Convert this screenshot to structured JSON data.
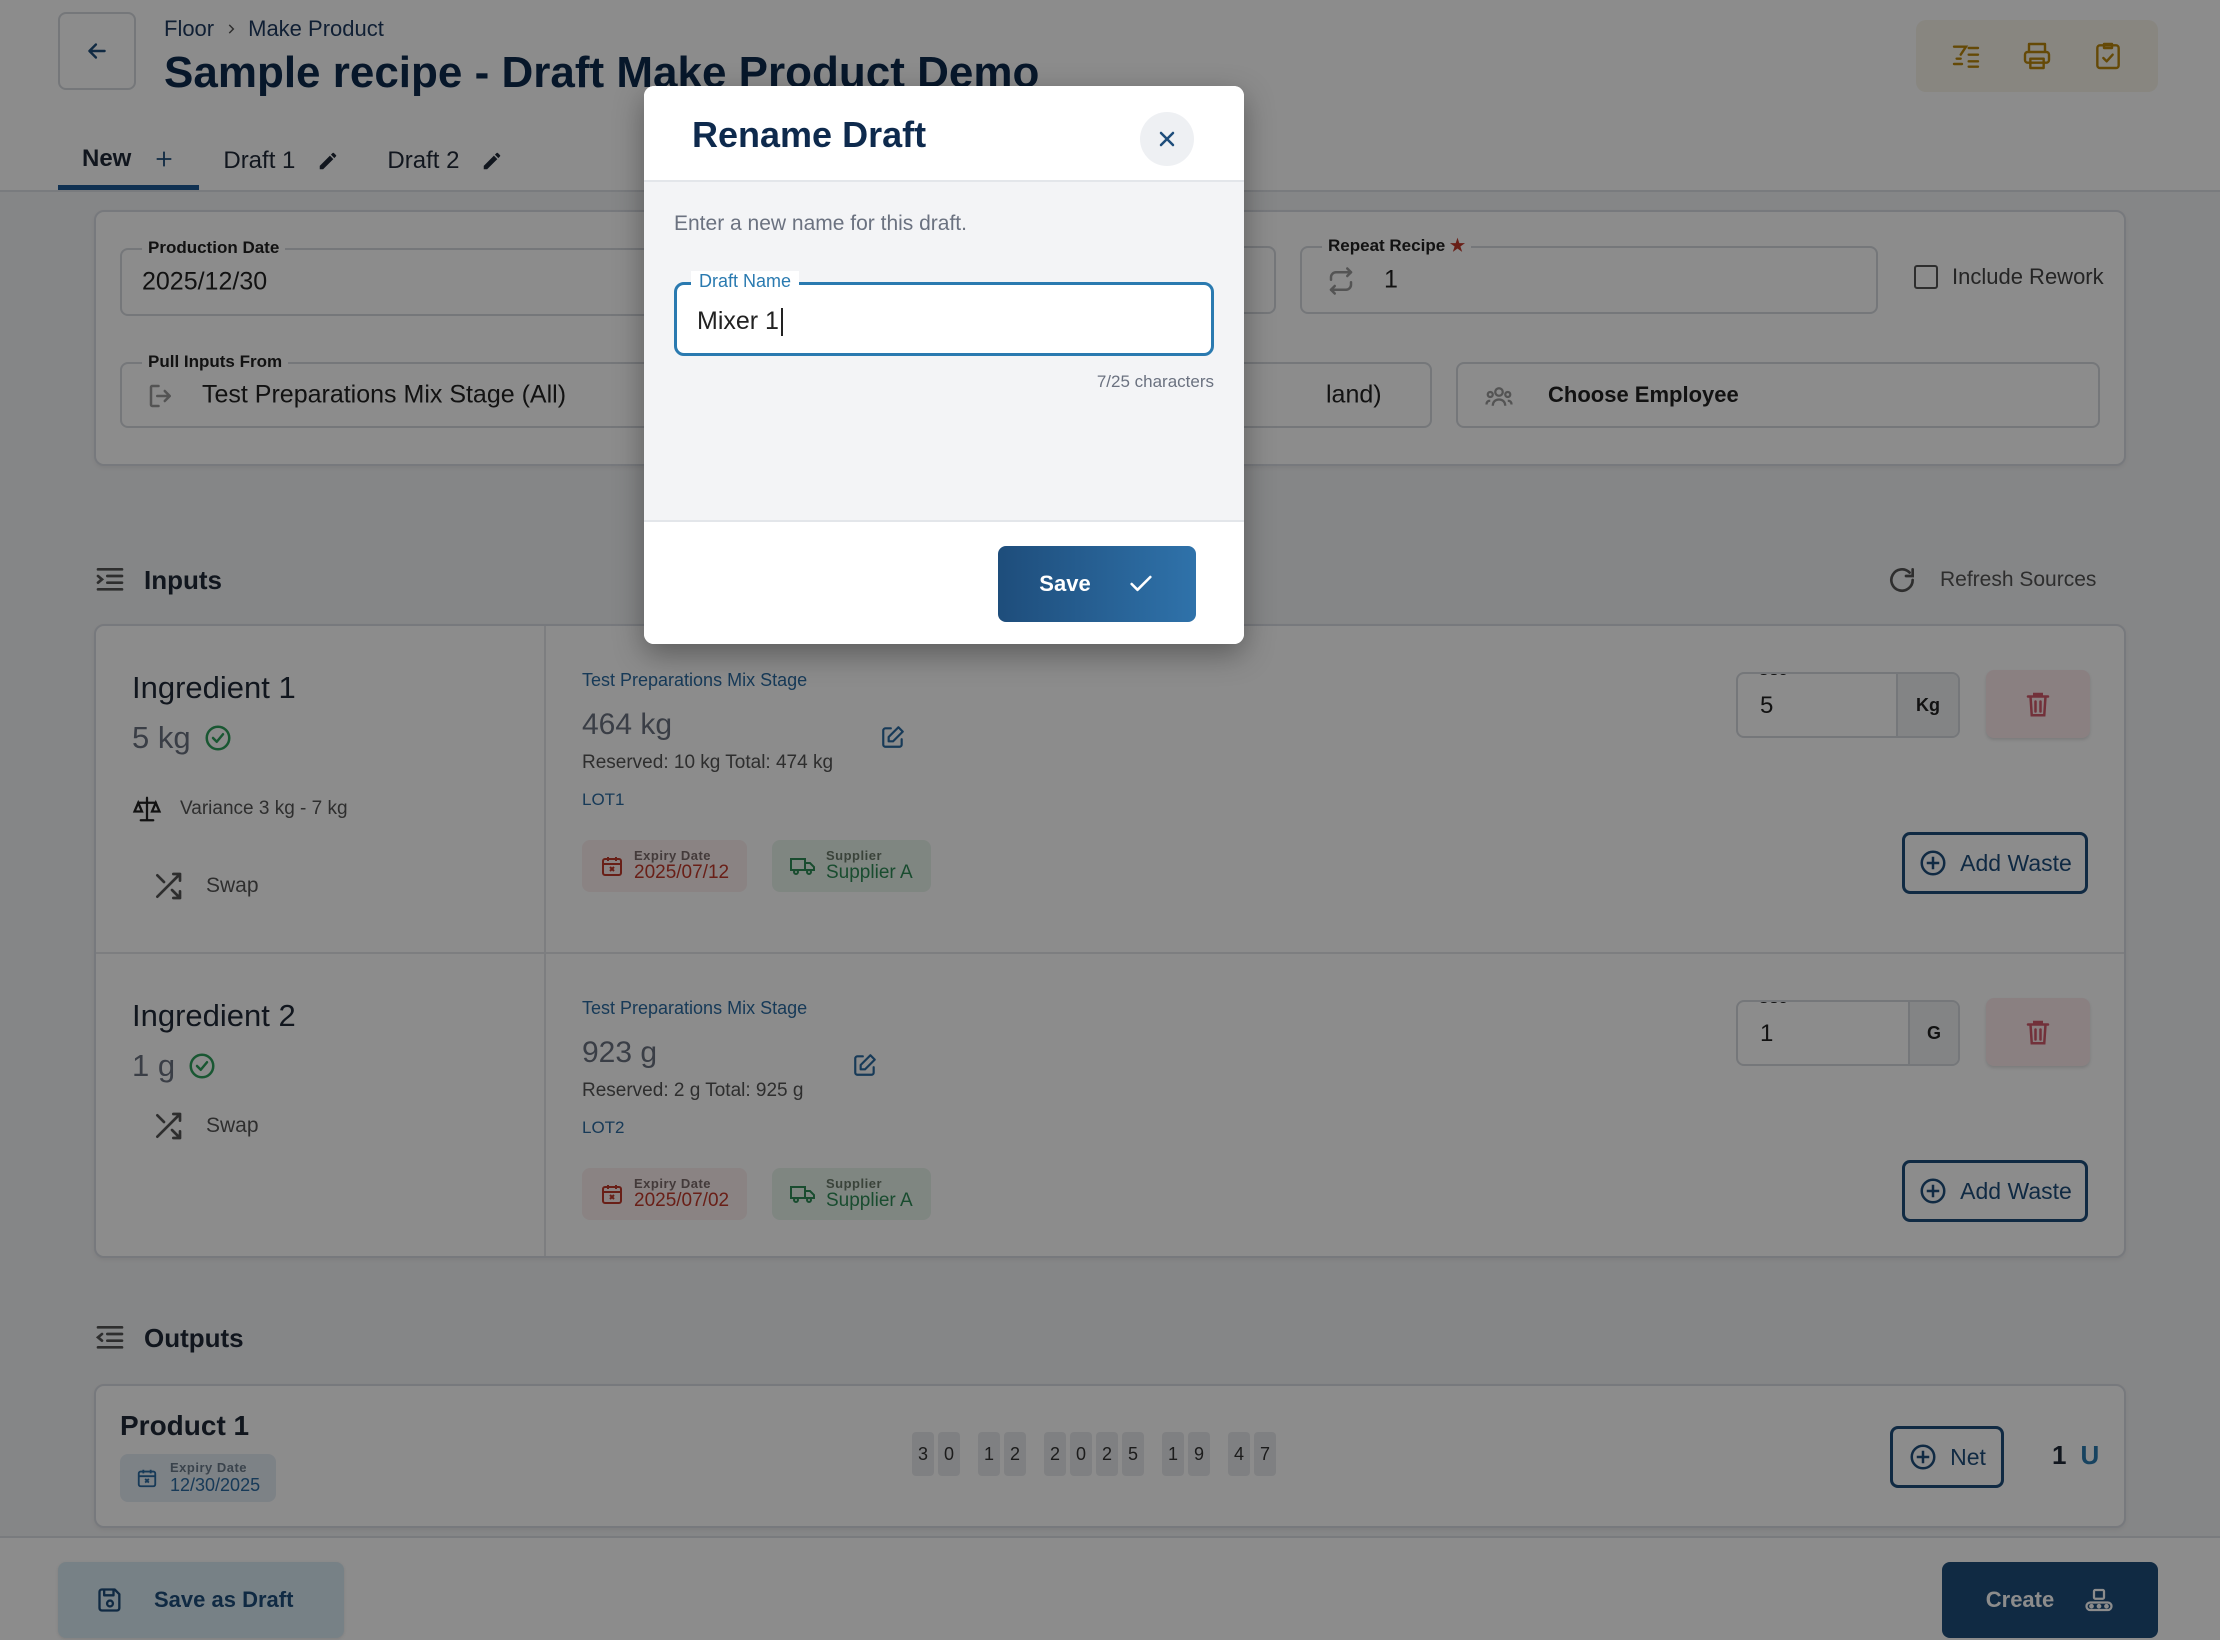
{
  "header": {
    "breadcrumb": [
      "Floor",
      "Make Product"
    ],
    "title": "Sample recipe - Draft Make Product Demo",
    "toolbar_icons": [
      "checklist-icon",
      "print-icon",
      "clipboard-check-icon"
    ]
  },
  "tabs": [
    {
      "label": "New",
      "active": true,
      "icon": "plus-icon"
    },
    {
      "label": "Draft 1",
      "active": false,
      "icon": "pencil-icon"
    },
    {
      "label": "Draft 2",
      "active": false,
      "icon": "pencil-icon"
    }
  ],
  "form": {
    "production_date": {
      "label": "Production Date",
      "value": "2025/12/30"
    },
    "repeat_recipe": {
      "label": "Repeat Recipe",
      "value": "1",
      "required_mark": "★"
    },
    "include_rework": {
      "label": "Include Rework",
      "checked": false
    },
    "pull_inputs": {
      "label": "Pull Inputs From",
      "value": "Test Preparations Mix Stage (All)"
    },
    "partial_value": "land)",
    "employee": {
      "placeholder": "Choose Employee"
    }
  },
  "inputs": {
    "title": "Inputs",
    "refresh_label": "Refresh Sources",
    "items": [
      {
        "name": "Ingredient 1",
        "amount": "5 kg",
        "variance": "Variance 3 kg - 7 kg",
        "swap_label": "Swap",
        "source": "Test Preparations Mix Stage",
        "quantity": "464 kg",
        "reserved": "Reserved: 10 kg Total: 474 kg",
        "lot": "LOT1",
        "expiry_label": "Expiry Date",
        "expiry": "2025/07/12",
        "supplier_label": "Supplier",
        "supplier": "Supplier A",
        "use_label": "Use",
        "use_value": "5",
        "use_unit": "Kg",
        "waste_label": "Add Waste"
      },
      {
        "name": "Ingredient 2",
        "amount": "1 g",
        "swap_label": "Swap",
        "source": "Test Preparations Mix Stage",
        "quantity": "923 g",
        "reserved": "Reserved: 2 g Total: 925 g",
        "lot": "LOT2",
        "expiry_label": "Expiry Date",
        "expiry": "2025/07/02",
        "supplier_label": "Supplier",
        "supplier": "Supplier A",
        "use_label": "Use",
        "use_value": "1",
        "use_unit": "G",
        "waste_label": "Add Waste"
      }
    ]
  },
  "outputs": {
    "title": "Outputs",
    "product": {
      "name": "Product 1",
      "expiry_label": "Expiry Date",
      "expiry": "12/30/2025",
      "code_groups": [
        [
          "3",
          "0"
        ],
        [
          "1",
          "2"
        ],
        [
          "2",
          "0",
          "2",
          "5"
        ],
        [
          "1",
          "9"
        ],
        [
          "4",
          "7"
        ]
      ],
      "net_label": "Net",
      "qty": "1",
      "unit": "U"
    }
  },
  "footer": {
    "save_draft_label": "Save as Draft",
    "create_label": "Create"
  },
  "modal": {
    "title": "Rename Draft",
    "description": "Enter a new name for this draft.",
    "field_label": "Draft Name",
    "field_value": "Mixer 1",
    "char_count": "7/25 characters",
    "save_label": "Save"
  },
  "colors": {
    "primary": "#1e4d7b",
    "accent_blue": "#2a7ab0",
    "danger": "#c0392b",
    "success": "#2e8b57",
    "gold_icon": "#b8860b"
  }
}
